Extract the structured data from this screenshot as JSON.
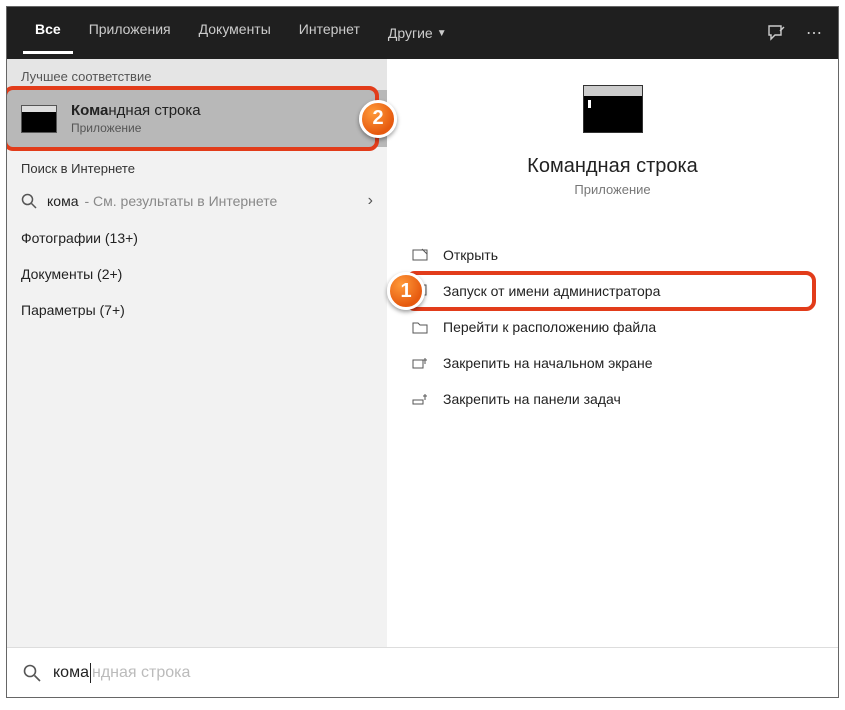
{
  "topbar": {
    "tabs": [
      "Все",
      "Приложения",
      "Документы",
      "Интернет",
      "Другие"
    ]
  },
  "left": {
    "best_match_label": "Лучшее соответствие",
    "best_match": {
      "title_hl": "Кома",
      "title_rest": "ндная строка",
      "subtitle": "Приложение"
    },
    "web_label": "Поиск в Интернете",
    "web_term": "кома",
    "web_desc": "- См. результаты в Интернете",
    "counts": {
      "photos": "Фотографии (13+)",
      "docs": "Документы (2+)",
      "params": "Параметры (7+)"
    }
  },
  "right": {
    "title": "Командная строка",
    "subtitle": "Приложение",
    "actions": {
      "open": "Открыть",
      "admin": "Запуск от имени администратора",
      "location": "Перейти к расположению файла",
      "pin_start": "Закрепить на начальном экране",
      "pin_taskbar": "Закрепить на панели задач"
    }
  },
  "search": {
    "typed": "кома",
    "ghost": "ндная строка"
  },
  "badges": {
    "one": "1",
    "two": "2"
  }
}
